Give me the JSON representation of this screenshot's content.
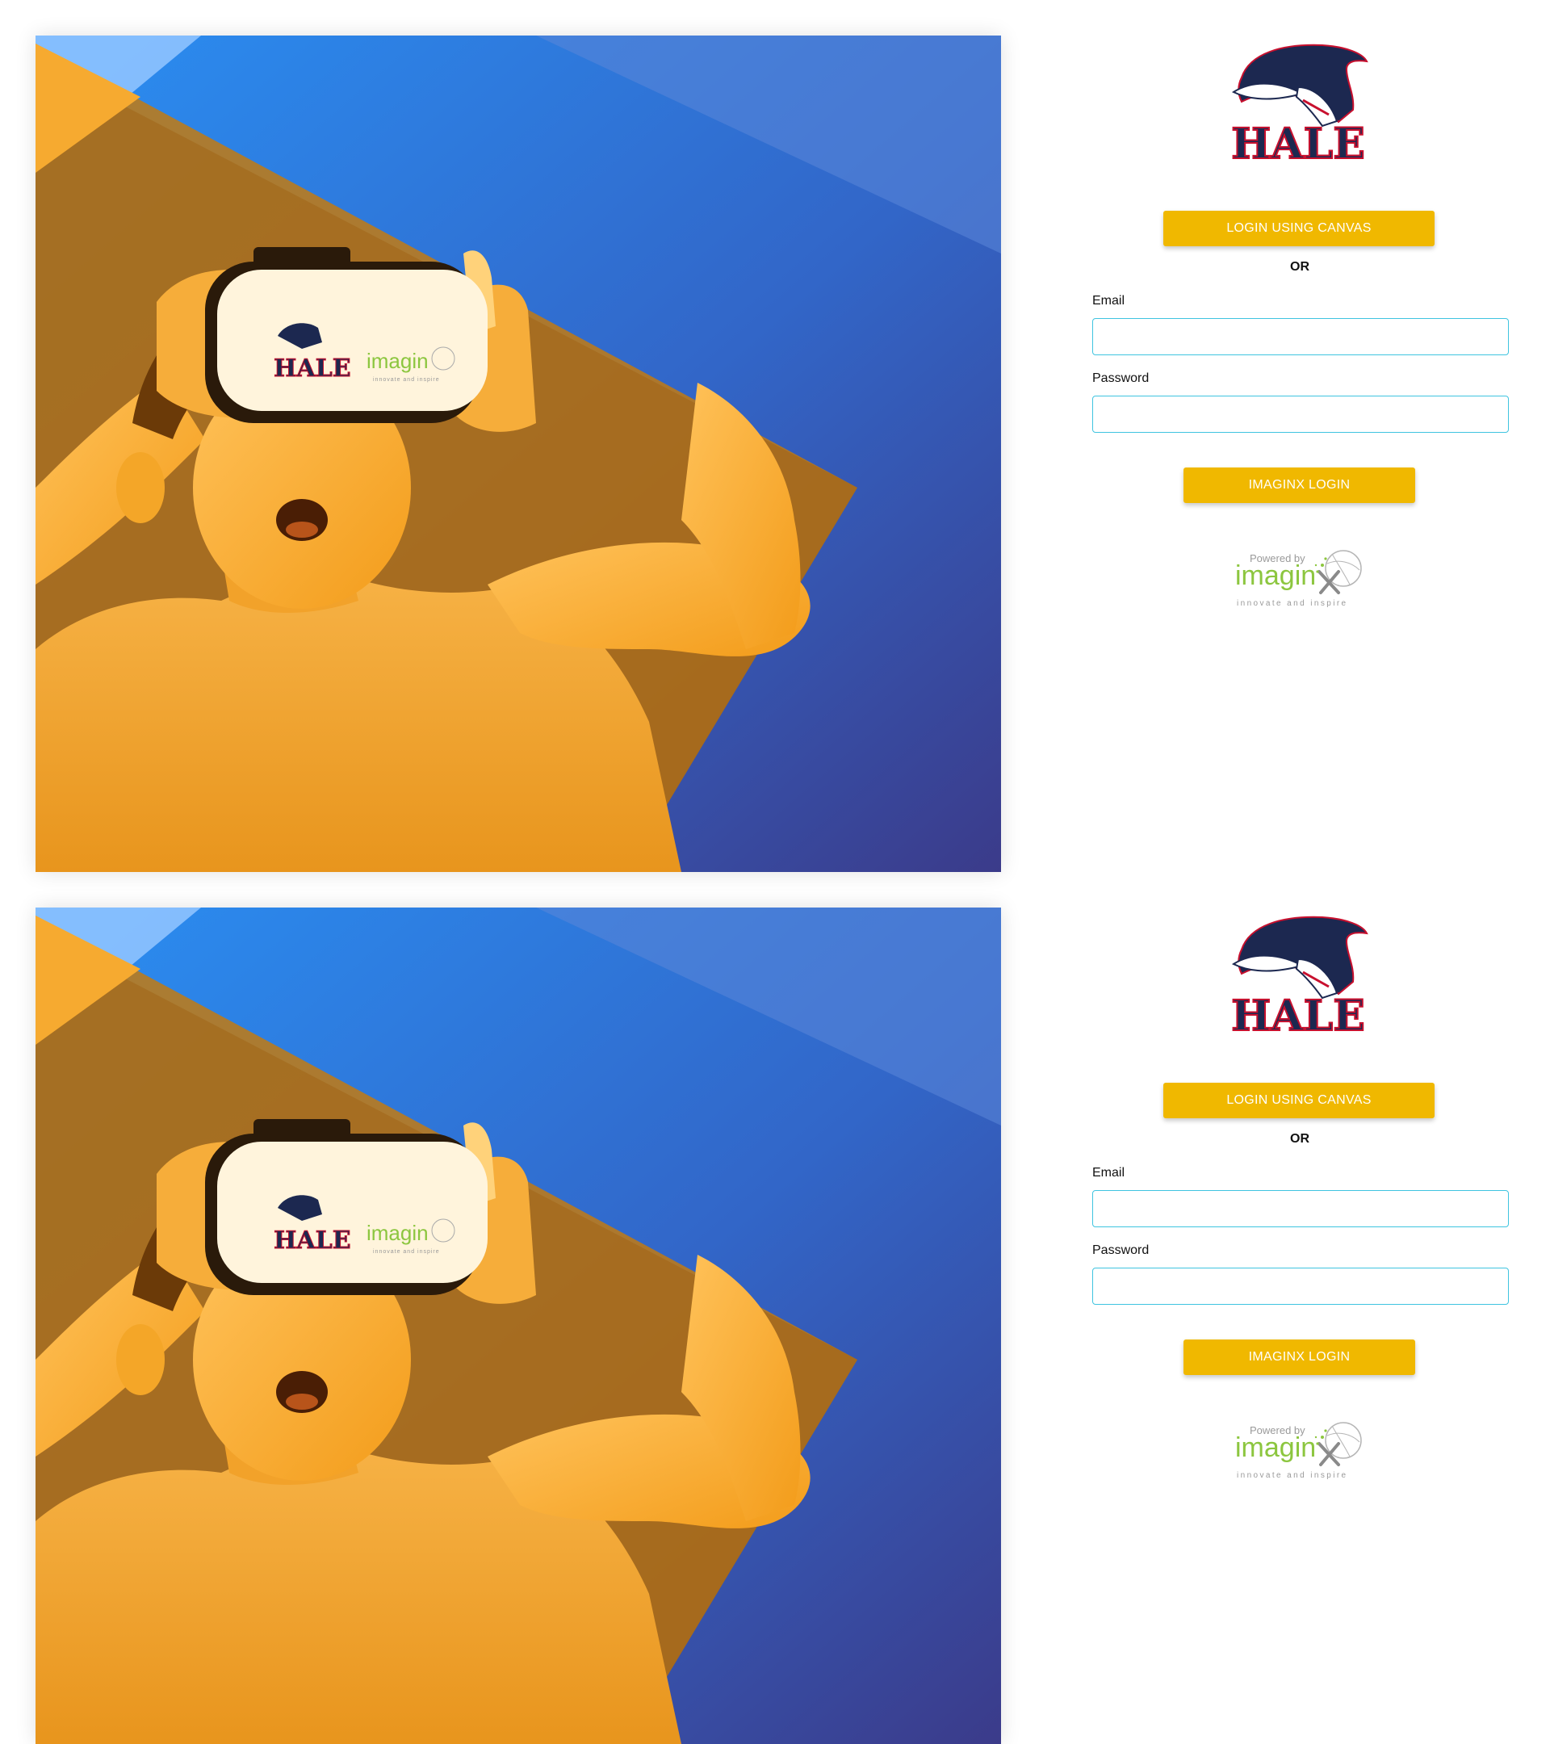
{
  "panels": [
    {
      "school": {
        "name": "HALE"
      },
      "headset": {
        "school_text": "HALE",
        "brand_text": "imagin",
        "tagline": "innovate and inspire"
      },
      "buttons": {
        "canvas_label": "LOGIN USING CANVAS",
        "imaginx_label": "IMAGINX LOGIN"
      },
      "or_text": "OR",
      "fields": {
        "email_label": "Email",
        "email_value": "",
        "password_label": "Password",
        "password_value": ""
      },
      "powered": {
        "prefix": "Powered by",
        "brand": "imagin",
        "tagline": "innovate and inspire"
      }
    },
    {
      "school": {
        "name": "HALE"
      },
      "headset": {
        "school_text": "HALE",
        "brand_text": "imagin",
        "tagline": "innovate and inspire"
      },
      "buttons": {
        "canvas_label": "LOGIN USING CANVAS",
        "imaginx_label": "IMAGINX LOGIN"
      },
      "or_text": "OR",
      "fields": {
        "email_label": "Email",
        "email_value": "",
        "password_label": "Password",
        "password_value": ""
      },
      "powered": {
        "prefix": "Powered by",
        "brand": "imagin",
        "tagline": "innovate and inspire"
      }
    }
  ],
  "colors": {
    "button": "#f0b800",
    "input_border": "#3fc4e0",
    "brand_green": "#8cc63f",
    "school_navy": "#1c2850",
    "school_red": "#c8102e",
    "hero_blue_top": "#2f8be6",
    "hero_blue_bottom": "#3b3f8f",
    "hero_orange": "#f6a21e"
  },
  "icons": {
    "school_mascot": "patriot-head-icon",
    "powered_logo": "globe-x-icon"
  }
}
